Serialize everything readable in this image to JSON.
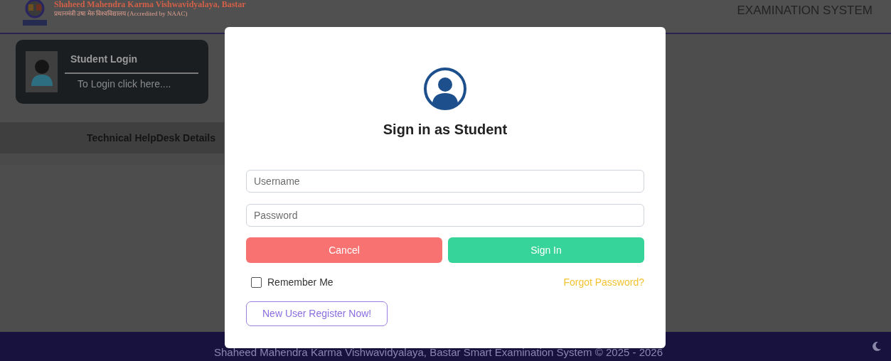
{
  "header": {
    "university_name": "Shaheed Mahendra Karma Vishwavidyalaya, Bastar",
    "subtitle": "प्रधानमंत्री उषा मेरु विश्वविद्यालय (Accredited by NAAC)",
    "system_title": "EXAMINATION SYSTEM"
  },
  "sidebar": {
    "login_card": {
      "title": "Student Login",
      "link": "To Login click here...."
    },
    "helpdesk": "Technical HelpDesk Details"
  },
  "modal": {
    "title": "Sign in as Student",
    "fields": [
      {
        "placeholder": "Username"
      },
      {
        "placeholder": "Password"
      }
    ],
    "buttons": [
      {
        "label": "Cancel",
        "kind": "cancel"
      },
      {
        "label": "Sign In",
        "kind": "submit"
      }
    ],
    "remember": {
      "label": "Remember Me",
      "checked": false
    },
    "forgot": "Forgot Password?",
    "register": "New User Register Now!"
  },
  "footer": {
    "text": "Shaheed Mahendra Karma Vishwavidyalaya, Bastar Smart Examination System © 2025 - 2026"
  }
}
